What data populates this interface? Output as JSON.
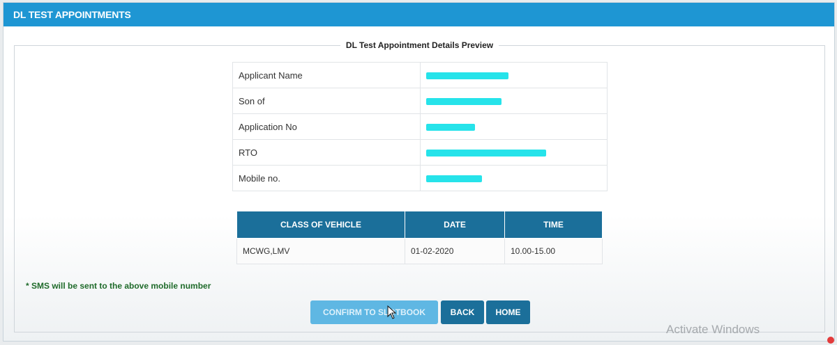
{
  "header": {
    "title": "DL TEST APPOINTMENTS"
  },
  "preview": {
    "legend": "DL Test Appointment Details Preview",
    "rows": [
      {
        "label": "Applicant Name",
        "redact_width": 118
      },
      {
        "label": "Son of",
        "redact_width": 108
      },
      {
        "label": "Application No",
        "redact_width": 70
      },
      {
        "label": "RTO",
        "redact_width": 172
      },
      {
        "label": "Mobile no.",
        "redact_width": 80
      }
    ]
  },
  "slot_table": {
    "headers": [
      "CLASS OF VEHICLE",
      "DATE",
      "TIME"
    ],
    "row": [
      "MCWG,LMV",
      "01-02-2020",
      "10.00-15.00"
    ]
  },
  "note": "* SMS will be sent to the above mobile number",
  "buttons": {
    "confirm": "CONFIRM TO SLOTBOOK",
    "back": "BACK",
    "home": "HOME"
  },
  "watermark": "Activate Windows",
  "colors": {
    "header_bg": "#1e96d3",
    "table_header_bg": "#1b6f9a",
    "redaction": "#26e3ea",
    "note_text": "#1f6b2a"
  }
}
